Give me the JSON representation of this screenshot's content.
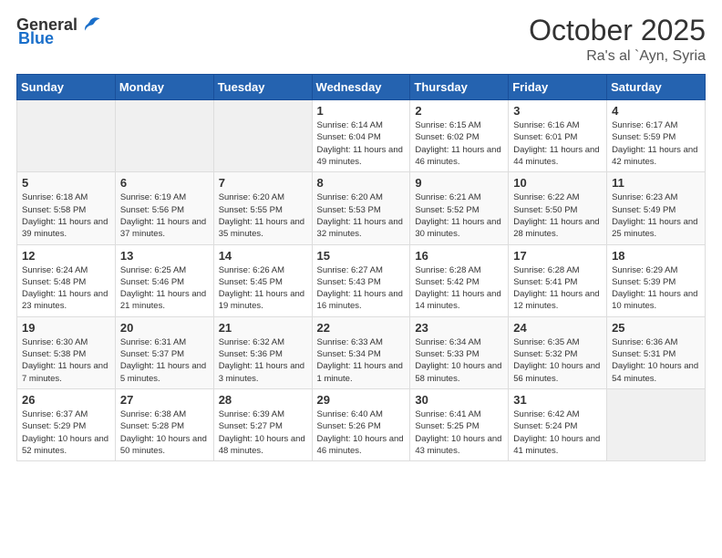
{
  "header": {
    "logo_general": "General",
    "logo_blue": "Blue",
    "month": "October 2025",
    "location": "Ra's al `Ayn, Syria"
  },
  "weekdays": [
    "Sunday",
    "Monday",
    "Tuesday",
    "Wednesday",
    "Thursday",
    "Friday",
    "Saturday"
  ],
  "weeks": [
    [
      {
        "day": "",
        "empty": true
      },
      {
        "day": "",
        "empty": true
      },
      {
        "day": "",
        "empty": true
      },
      {
        "day": "1",
        "info": "Sunrise: 6:14 AM\nSunset: 6:04 PM\nDaylight: 11 hours\nand 49 minutes."
      },
      {
        "day": "2",
        "info": "Sunrise: 6:15 AM\nSunset: 6:02 PM\nDaylight: 11 hours\nand 46 minutes."
      },
      {
        "day": "3",
        "info": "Sunrise: 6:16 AM\nSunset: 6:01 PM\nDaylight: 11 hours\nand 44 minutes."
      },
      {
        "day": "4",
        "info": "Sunrise: 6:17 AM\nSunset: 5:59 PM\nDaylight: 11 hours\nand 42 minutes."
      }
    ],
    [
      {
        "day": "5",
        "info": "Sunrise: 6:18 AM\nSunset: 5:58 PM\nDaylight: 11 hours\nand 39 minutes."
      },
      {
        "day": "6",
        "info": "Sunrise: 6:19 AM\nSunset: 5:56 PM\nDaylight: 11 hours\nand 37 minutes."
      },
      {
        "day": "7",
        "info": "Sunrise: 6:20 AM\nSunset: 5:55 PM\nDaylight: 11 hours\nand 35 minutes."
      },
      {
        "day": "8",
        "info": "Sunrise: 6:20 AM\nSunset: 5:53 PM\nDaylight: 11 hours\nand 32 minutes."
      },
      {
        "day": "9",
        "info": "Sunrise: 6:21 AM\nSunset: 5:52 PM\nDaylight: 11 hours\nand 30 minutes."
      },
      {
        "day": "10",
        "info": "Sunrise: 6:22 AM\nSunset: 5:50 PM\nDaylight: 11 hours\nand 28 minutes."
      },
      {
        "day": "11",
        "info": "Sunrise: 6:23 AM\nSunset: 5:49 PM\nDaylight: 11 hours\nand 25 minutes."
      }
    ],
    [
      {
        "day": "12",
        "info": "Sunrise: 6:24 AM\nSunset: 5:48 PM\nDaylight: 11 hours\nand 23 minutes."
      },
      {
        "day": "13",
        "info": "Sunrise: 6:25 AM\nSunset: 5:46 PM\nDaylight: 11 hours\nand 21 minutes."
      },
      {
        "day": "14",
        "info": "Sunrise: 6:26 AM\nSunset: 5:45 PM\nDaylight: 11 hours\nand 19 minutes."
      },
      {
        "day": "15",
        "info": "Sunrise: 6:27 AM\nSunset: 5:43 PM\nDaylight: 11 hours\nand 16 minutes."
      },
      {
        "day": "16",
        "info": "Sunrise: 6:28 AM\nSunset: 5:42 PM\nDaylight: 11 hours\nand 14 minutes."
      },
      {
        "day": "17",
        "info": "Sunrise: 6:28 AM\nSunset: 5:41 PM\nDaylight: 11 hours\nand 12 minutes."
      },
      {
        "day": "18",
        "info": "Sunrise: 6:29 AM\nSunset: 5:39 PM\nDaylight: 11 hours\nand 10 minutes."
      }
    ],
    [
      {
        "day": "19",
        "info": "Sunrise: 6:30 AM\nSunset: 5:38 PM\nDaylight: 11 hours\nand 7 minutes."
      },
      {
        "day": "20",
        "info": "Sunrise: 6:31 AM\nSunset: 5:37 PM\nDaylight: 11 hours\nand 5 minutes."
      },
      {
        "day": "21",
        "info": "Sunrise: 6:32 AM\nSunset: 5:36 PM\nDaylight: 11 hours\nand 3 minutes."
      },
      {
        "day": "22",
        "info": "Sunrise: 6:33 AM\nSunset: 5:34 PM\nDaylight: 11 hours\nand 1 minute."
      },
      {
        "day": "23",
        "info": "Sunrise: 6:34 AM\nSunset: 5:33 PM\nDaylight: 10 hours\nand 58 minutes."
      },
      {
        "day": "24",
        "info": "Sunrise: 6:35 AM\nSunset: 5:32 PM\nDaylight: 10 hours\nand 56 minutes."
      },
      {
        "day": "25",
        "info": "Sunrise: 6:36 AM\nSunset: 5:31 PM\nDaylight: 10 hours\nand 54 minutes."
      }
    ],
    [
      {
        "day": "26",
        "info": "Sunrise: 6:37 AM\nSunset: 5:29 PM\nDaylight: 10 hours\nand 52 minutes."
      },
      {
        "day": "27",
        "info": "Sunrise: 6:38 AM\nSunset: 5:28 PM\nDaylight: 10 hours\nand 50 minutes."
      },
      {
        "day": "28",
        "info": "Sunrise: 6:39 AM\nSunset: 5:27 PM\nDaylight: 10 hours\nand 48 minutes."
      },
      {
        "day": "29",
        "info": "Sunrise: 6:40 AM\nSunset: 5:26 PM\nDaylight: 10 hours\nand 46 minutes."
      },
      {
        "day": "30",
        "info": "Sunrise: 6:41 AM\nSunset: 5:25 PM\nDaylight: 10 hours\nand 43 minutes."
      },
      {
        "day": "31",
        "info": "Sunrise: 6:42 AM\nSunset: 5:24 PM\nDaylight: 10 hours\nand 41 minutes."
      },
      {
        "day": "",
        "empty": true
      }
    ]
  ]
}
